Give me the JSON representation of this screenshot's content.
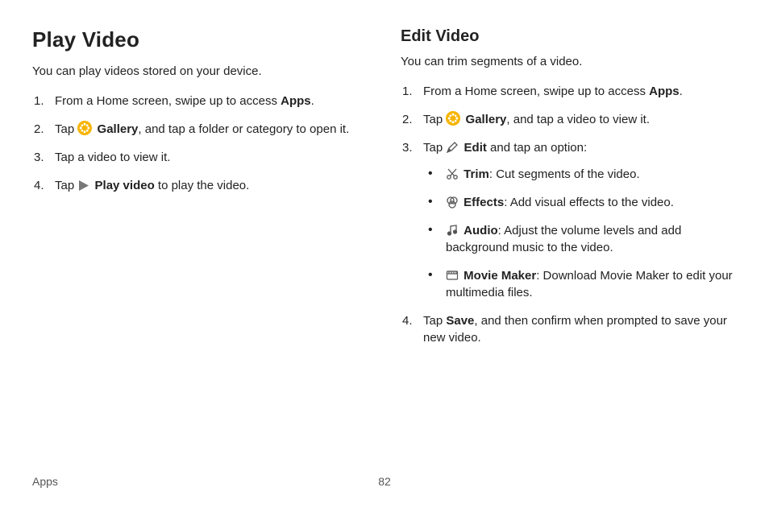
{
  "footer": {
    "section": "Apps",
    "page": "82"
  },
  "left": {
    "title": "Play Video",
    "lead": "You can play videos stored on your device.",
    "step1_pre": "From a Home screen, swipe up to access ",
    "step1_bold": "Apps",
    "step1_post": ".",
    "step2_pre": "Tap ",
    "step2_bold": "Gallery",
    "step2_post": ", and tap a folder or category to open it.",
    "step3": "Tap a video to view it.",
    "step4_pre": "Tap ",
    "step4_bold": "Play video",
    "step4_post": " to play the video."
  },
  "right": {
    "title": "Edit Video",
    "lead": "You can trim segments of a video.",
    "step1_pre": "From a Home screen, swipe up to access ",
    "step1_bold": "Apps",
    "step1_post": ".",
    "step2_pre": "Tap ",
    "step2_bold": "Gallery",
    "step2_post": ", and tap a video to view it.",
    "step3_pre": "Tap ",
    "step3_bold": "Edit",
    "step3_post": " and tap an option:",
    "trim_bold": "Trim",
    "trim_post": ": Cut segments of the video.",
    "effects_bold": "Effects",
    "effects_post": ": Add visual effects to the video.",
    "audio_bold": "Audio",
    "audio_post": ": Adjust the volume levels and add background music to the video.",
    "movie_bold": "Movie Maker",
    "movie_post": ": Download Movie Maker to edit your multimedia files.",
    "step4_pre": "Tap ",
    "step4_bold": "Save",
    "step4_post": ", and then confirm when prompted to save your new video."
  }
}
